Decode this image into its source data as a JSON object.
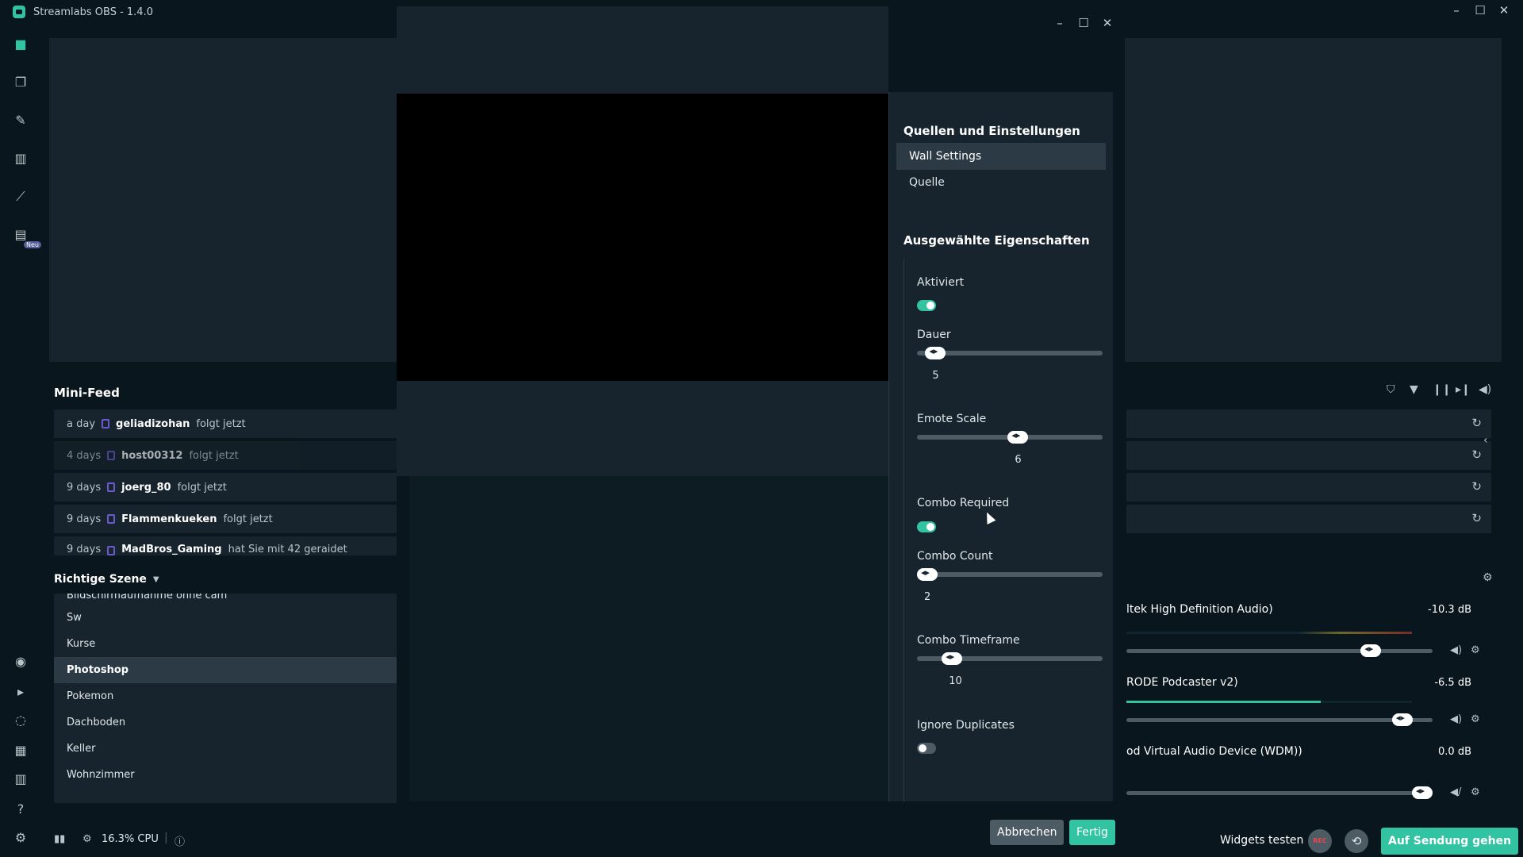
{
  "app": {
    "title": "Streamlabs OBS - 1.4.0"
  },
  "nav": {
    "new_badge": "Neu"
  },
  "minifeed": {
    "title": "Mini-Feed",
    "rows": [
      {
        "time": "a day",
        "user": "geliadizohan",
        "action": "folgt jetzt"
      },
      {
        "time": "4 days",
        "user": "host00312",
        "action": "folgt jetzt"
      },
      {
        "time": "9 days",
        "user": "joerg_80",
        "action": "folgt jetzt"
      },
      {
        "time": "9 days",
        "user": "Flammenkueken",
        "action": "folgt jetzt"
      },
      {
        "time": "9 days",
        "user": "MadBros_Gaming",
        "action": "hat Sie mit 42 geraidet"
      }
    ]
  },
  "scenes": {
    "title": "Richtige Szene",
    "items": [
      "Bildschirmaufnahme ohne cam",
      "Sw",
      "Kurse",
      "Photoshop",
      "Pokemon",
      "Dachboden",
      "Keller",
      "Wohnzimmer"
    ],
    "active_index": 3
  },
  "mixer": {
    "sources": [
      {
        "name": "ltek High Definition Audio)",
        "db": "-10.3 dB",
        "level": 0.82
      },
      {
        "name": "RODE Podcaster v2)",
        "db": "-6.5 dB",
        "level": 0.93
      },
      {
        "name": "od Virtual Audio Device (WDM))",
        "db": "0.0 dB",
        "level": 1.0
      }
    ]
  },
  "status": {
    "cpu": "16.3% CPU"
  },
  "footer": {
    "widgets_test": "Widgets testen",
    "rec": "REC",
    "go_live": "Auf Sendung gehen"
  },
  "modal": {
    "sources_heading": "Quellen und Einstellungen",
    "tabs": [
      "Wall Settings",
      "Quelle"
    ],
    "properties_heading": "Ausgewählte Eigenschaften",
    "fields": {
      "enabled": {
        "label": "Aktiviert",
        "value": true
      },
      "duration": {
        "label": "Dauer",
        "value": "5",
        "fraction": 0.05
      },
      "emote_scale": {
        "label": "Emote Scale",
        "value": "6",
        "fraction": 0.55
      },
      "combo_required": {
        "label": "Combo Required",
        "value": true
      },
      "combo_count": {
        "label": "Combo Count",
        "value": "2",
        "fraction": 0.0
      },
      "combo_timeframe": {
        "label": "Combo Timeframe",
        "value": "10",
        "fraction": 0.15
      },
      "ignore_duplicates": {
        "label": "Ignore Duplicates",
        "value": false
      }
    },
    "cancel": "Abbrechen",
    "done": "Fertig"
  }
}
